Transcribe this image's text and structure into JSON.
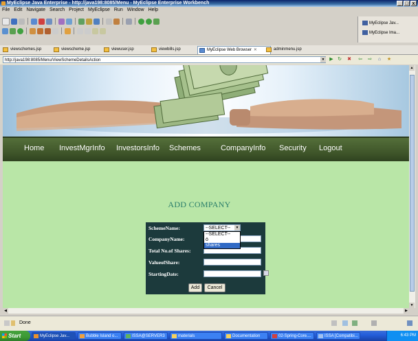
{
  "window": {
    "title": "MyEclipse Java Enterprise - http://java198:8085/Menu - MyEclipse Enterprise Workbench",
    "controls": [
      "_",
      "□",
      "x"
    ]
  },
  "menubar": [
    "File",
    "Edit",
    "Navigate",
    "Search",
    "Project",
    "MyEclipse",
    "Run",
    "Window",
    "Help"
  ],
  "perspectives": [
    "MyEclipse Jav...",
    "MyEclipse Ima..."
  ],
  "tabs": [
    "viewschemes.jsp",
    "viewscheme.jsp",
    "viewuser.jsp",
    "viewbills.jsp",
    "MyEclipse Web Browser",
    "adminmenu.jsp"
  ],
  "browser": {
    "url": "http://java198:8085/Menu/ViewSchemeDetailsAction"
  },
  "nav": [
    "Home",
    "InvestMgrInfo",
    "InvestorsInfo",
    "Schemes",
    "CompanyInfo",
    "Security",
    "Logout"
  ],
  "page": {
    "heading": "ADD COMPANY"
  },
  "form": {
    "labels": [
      "SchemeName:",
      "CompanyName:",
      "Total No.of Shares:",
      "ValueofShare:",
      "StartingDate:"
    ],
    "scheme_selected": "--SELECT--",
    "scheme_options": [
      "--SELECT--",
      "ö",
      "shares"
    ],
    "add_label": "Add",
    "cancel_label": "Cancel"
  },
  "status": {
    "text": "Done"
  },
  "taskbar": {
    "start": "Start",
    "tasks": [
      "MyEclipse Jav...",
      "Bubble Island o...",
      "ISSA@SERVER3",
      "materials",
      "Documentation",
      "02-Spring-Core....",
      "ISSA [Compatibi..."
    ],
    "clock": "6:43 PM"
  },
  "colors": {
    "page_bg": "#b9e6a7",
    "nav_bg": "#3d5328",
    "form_bg": "#1c3a3c",
    "heading": "#2a7e6a"
  }
}
